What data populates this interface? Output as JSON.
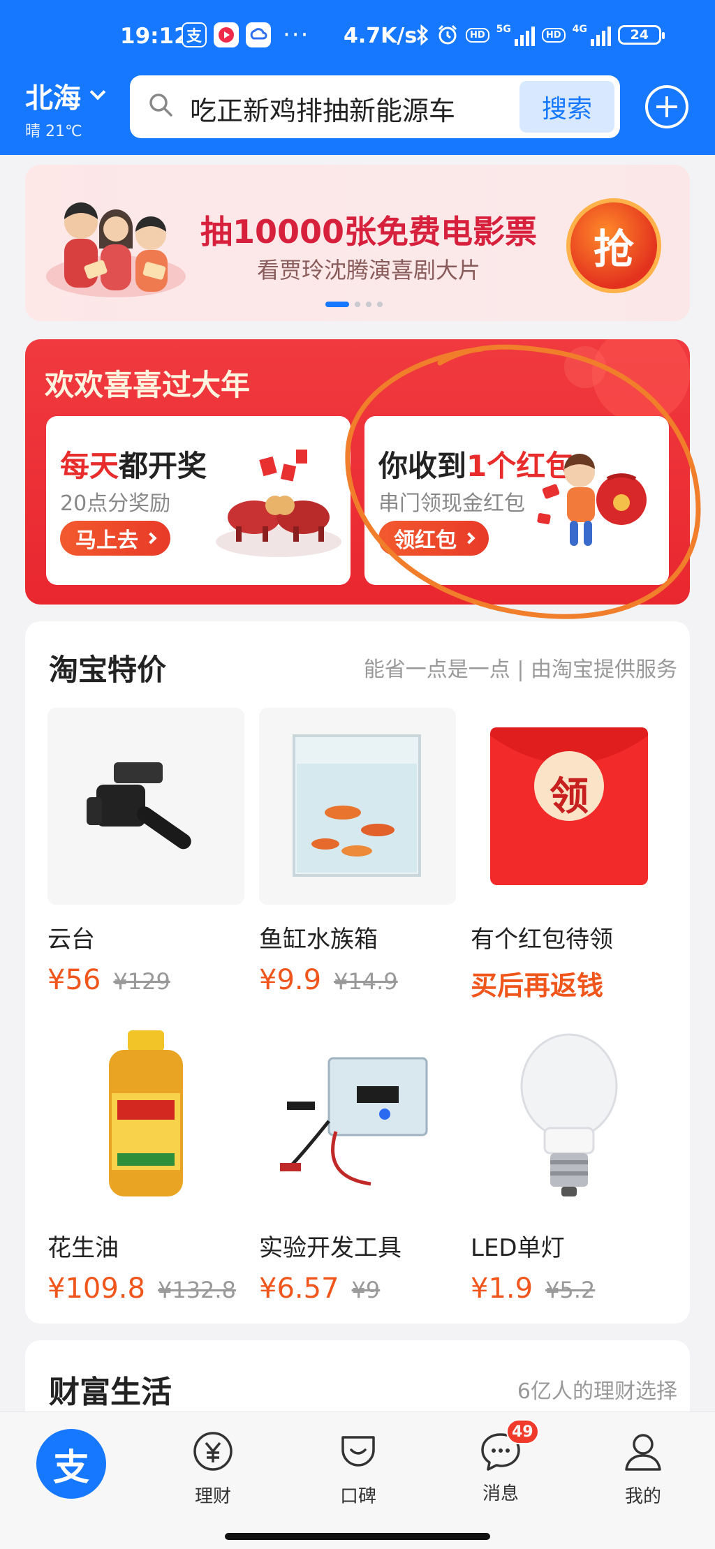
{
  "status_bar": {
    "time": "19:12",
    "dots": "···",
    "network_speed": "4.7K/s",
    "hd_label": "HD",
    "signal1_label": "5G",
    "signal2_label": "4G",
    "battery": "24"
  },
  "header": {
    "city": "北海",
    "weather": "晴 21℃",
    "search_placeholder": "吃正新鸡排抽新能源车",
    "search_button": "搜索"
  },
  "banner": {
    "title": "抽10000张免费电影票",
    "subtitle": "看贾玲沈腾演喜剧大片",
    "grab_button": "抢",
    "active_index": 0
  },
  "new_year": {
    "title": "欢欢喜喜过大年",
    "card1": {
      "title_red": "每天",
      "title_rest": "都开奖",
      "subtitle": "20点分奖励",
      "button": "马上去"
    },
    "card2": {
      "title_pre": "你收到",
      "title_red": "1个红包",
      "subtitle": "串门领现金红包",
      "button": "领红包"
    }
  },
  "taobao": {
    "title": "淘宝特价",
    "subtitle": "能省一点是一点 | 由淘宝提供服务",
    "products": [
      {
        "name": "云台",
        "price": "¥56",
        "old_price": "¥129"
      },
      {
        "name": "鱼缸水族箱",
        "price": "¥9.9",
        "old_price": "¥14.9"
      },
      {
        "name": "有个红包待领",
        "promo": "买后再返钱",
        "img_label": "领"
      },
      {
        "name": "花生油",
        "price": "¥109.8",
        "old_price": "¥132.8"
      },
      {
        "name": "实验开发工具",
        "price": "¥6.57",
        "old_price": "¥9"
      },
      {
        "name": "LED单灯",
        "price": "¥1.9",
        "old_price": "¥5.2"
      }
    ]
  },
  "wealth": {
    "title": "财富生活",
    "subtitle": "6亿人的理财选择"
  },
  "nav": {
    "home_glyph": "支",
    "items": [
      {
        "label": "理财"
      },
      {
        "label": "口碑"
      },
      {
        "label": "消息",
        "badge": "49"
      },
      {
        "label": "我的"
      }
    ]
  },
  "colors": {
    "brand_blue": "#1677ff",
    "red": "#e82c2c",
    "price_orange": "#f0561c"
  }
}
